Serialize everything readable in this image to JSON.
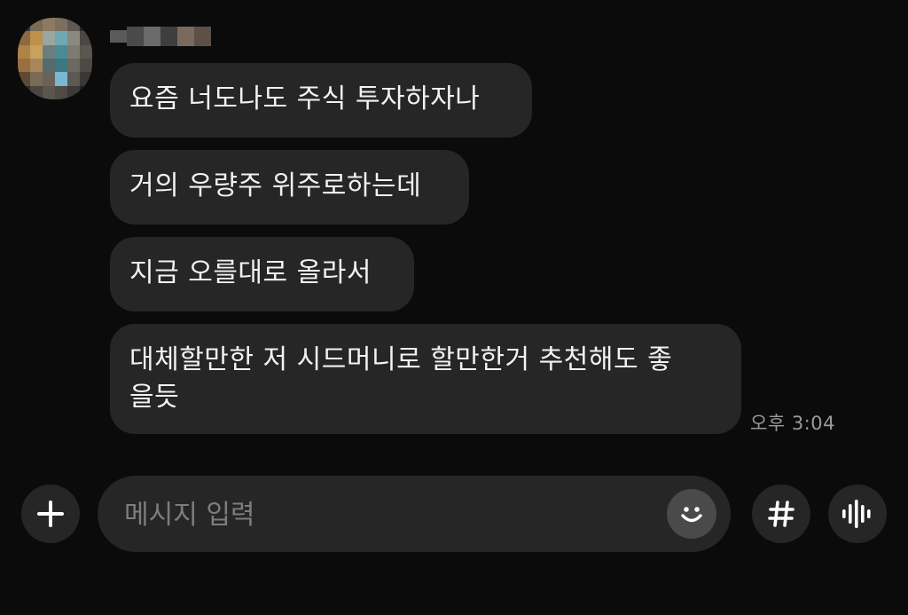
{
  "conversation": {
    "messages": [
      {
        "text": "요즘 너도나도 주식 투자하자나"
      },
      {
        "text": "거의 우량주 위주로하는데"
      },
      {
        "text": "지금 오를대로 올라서"
      },
      {
        "text": "대체할만한 저 시드머니로 할만한거 추천해도 좋\n을듯"
      }
    ],
    "timestamp": "오후 3:04"
  },
  "composer": {
    "placeholder": "메시지 입력"
  },
  "icons": {
    "attach": "plus-icon",
    "emoji": "smile-icon",
    "hashtag": "hash-icon",
    "voice": "voice-wave-icon"
  },
  "colors": {
    "background": "#0b0b0b",
    "bubble": "#262626",
    "text": "#f2f2f2",
    "timestamp": "#9a9a9a",
    "placeholder": "#7d7d7d"
  }
}
